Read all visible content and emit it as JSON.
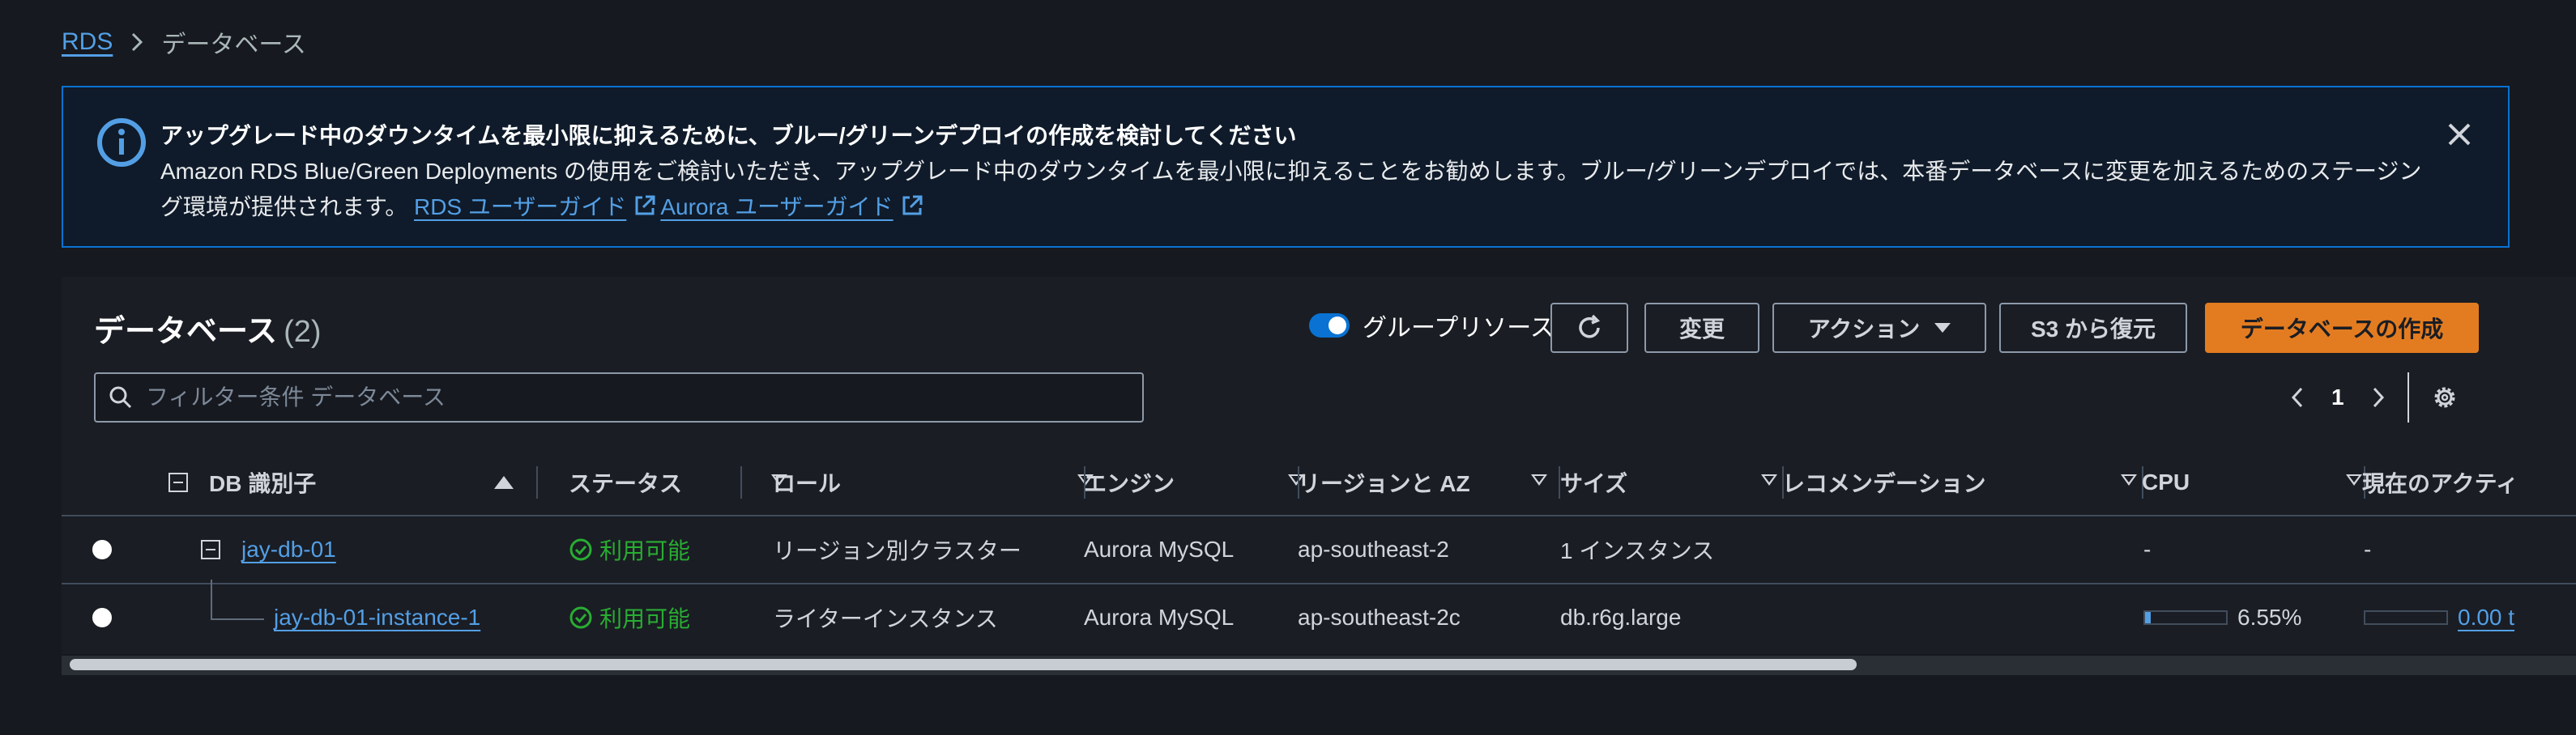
{
  "breadcrumb": {
    "root": "RDS",
    "current": "データベース"
  },
  "banner": {
    "title": "アップグレード中のダウンタイムを最小限に抑えるために、ブルー/グリーンデプロイの作成を検討してください",
    "body_line1": "Amazon RDS Blue/Green Deployments の使用をご検討いただき、アップグレード中のダウンタイムを最小限に抑えることをお勧めします。ブルー/グリーンデプロイでは、本番データベースに変更を加えるためのステージン",
    "body_line2": "グ環境が提供されます。",
    "link1": "RDS ユーザーガイド",
    "link2": "Aurora ユーザーガイド",
    "icon": "info-icon"
  },
  "header": {
    "title": "データベース",
    "count": "(2)",
    "group_toggle_label": "グループリソース",
    "group_toggle_on": true,
    "modify_label": "変更",
    "actions_label": "アクション",
    "restore_label": "S3 から復元",
    "create_label": "データベースの作成"
  },
  "search": {
    "placeholder": "フィルター条件 データベース"
  },
  "pager": {
    "page": "1"
  },
  "table": {
    "columns": [
      "DB 識別子",
      "ステータス",
      "ロール",
      "エンジン",
      "リージョンと AZ",
      "サイズ",
      "レコメンデーション",
      "CPU",
      "現在のアクティ"
    ],
    "rows": [
      {
        "id": "jay-db-01",
        "status": "利用可能",
        "role": "リージョン別クラスター",
        "engine": "Aurora MySQL",
        "region": "ap-southeast-2",
        "size": "1 インスタンス",
        "recommendation": "",
        "cpu": "-",
        "activity": "-"
      },
      {
        "id": "jay-db-01-instance-1",
        "status": "利用可能",
        "role": "ライターインスタンス",
        "engine": "Aurora MySQL",
        "region": "ap-southeast-2c",
        "size": "db.r6g.large",
        "recommendation": "",
        "cpu": "6.55%",
        "cpu_fraction": 0.0655,
        "activity": "0.00 t",
        "activity_fraction": 0.0
      }
    ]
  },
  "colors": {
    "accent": "#0972d3",
    "primary_button": "#e37c20",
    "success": "#29ad32",
    "link": "#539fe5"
  }
}
